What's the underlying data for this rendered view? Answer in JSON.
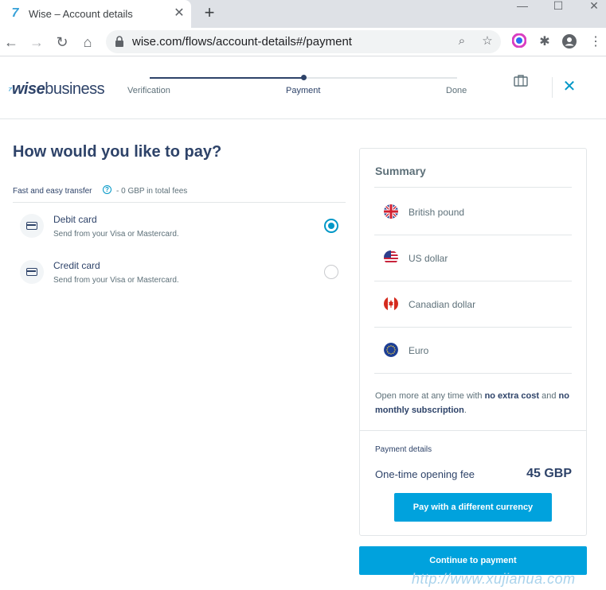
{
  "browser": {
    "tab_title": "Wise – Account details",
    "url": "wise.com/flows/account-details#/payment"
  },
  "header": {
    "logo_wise": "wise",
    "logo_business": "business",
    "steps": [
      "Verification",
      "Payment",
      "Done"
    ],
    "progress_fraction": 0.5
  },
  "main": {
    "title": "How would you like to pay?",
    "section_label": "Fast and easy transfer",
    "fee_note": "- 0 GBP in total fees",
    "options": [
      {
        "title": "Debit card",
        "subtitle": "Send from your Visa or Mastercard.",
        "selected": true
      },
      {
        "title": "Credit card",
        "subtitle": "Send from your Visa or Mastercard.",
        "selected": false
      }
    ]
  },
  "summary": {
    "title": "Summary",
    "currencies": [
      {
        "name": "British pound",
        "flag": "uk-flag-icon"
      },
      {
        "name": "US dollar",
        "flag": "us-flag-icon"
      },
      {
        "name": "Canadian dollar",
        "flag": "canada-flag-icon"
      },
      {
        "name": "Euro",
        "flag": "eu-flag-icon"
      }
    ],
    "open_more_prefix": "Open more at any time with ",
    "open_more_bold1": "no extra cost",
    "open_more_mid": " and ",
    "open_more_bold2": "no monthly subscription",
    "open_more_suffix": ".",
    "payment_details_label": "Payment details",
    "fee_label": "One-time opening fee",
    "fee_amount": "45 GBP",
    "different_currency_button": "Pay with a different currency"
  },
  "continue_button": "Continue to payment",
  "watermark": "http://www.xujianua.com",
  "colors": {
    "accent": "#00a2dd",
    "navy": "#2e4369",
    "muted": "#5d7079"
  }
}
